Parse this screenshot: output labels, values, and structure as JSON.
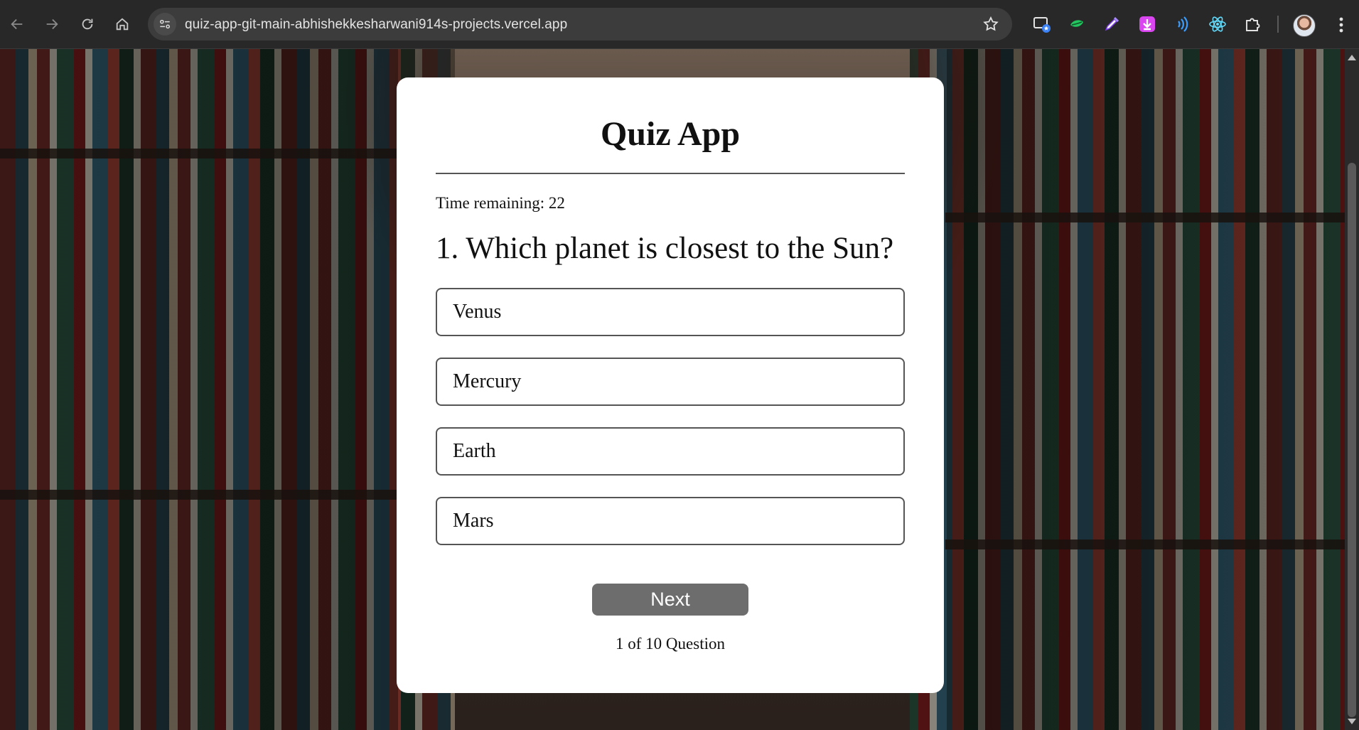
{
  "browser": {
    "url": "quiz-app-git-main-abhishekkesharwani914s-projects.vercel.app",
    "extensions": [
      "cast-icon",
      "leaf-extension-icon",
      "eyedropper-icon",
      "download-extension-icon",
      "wifi-extension-icon",
      "react-icon",
      "puzzle-icon"
    ]
  },
  "quiz": {
    "title": "Quiz App",
    "timer_label": "Time remaining: 22",
    "question": "1. Which planet is closest to the Sun?",
    "options": [
      "Venus",
      "Mercury",
      "Earth",
      "Mars"
    ],
    "next_label": "Next",
    "progress_label": "1 of 10 Question"
  },
  "colors": {
    "card_bg": "#ffffff",
    "button_bg": "#6d6d6d",
    "border": "#555555"
  }
}
